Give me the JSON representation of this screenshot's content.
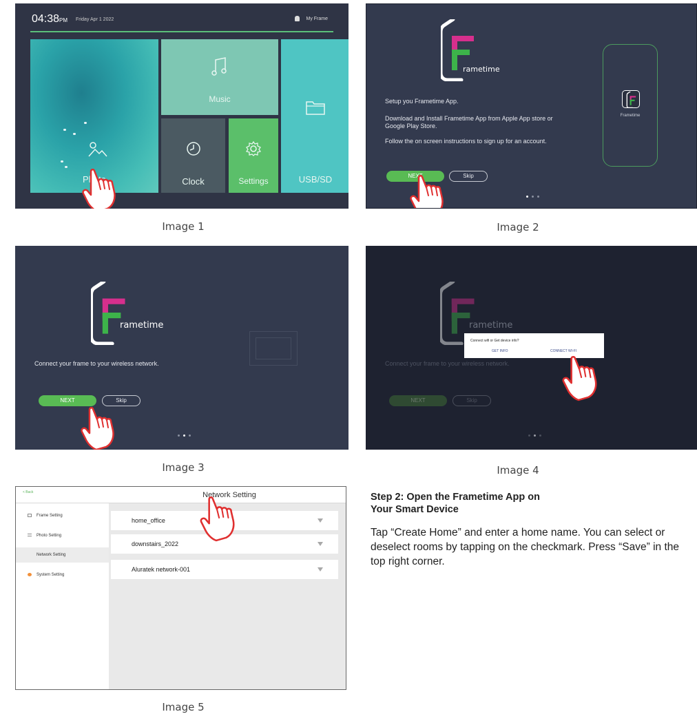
{
  "image1": {
    "time": "04:38",
    "ampm": "PM",
    "date": "Friday Apr 1 2022",
    "user_label": "My Frame",
    "tiles": {
      "photo": "Photo",
      "music": "Music",
      "clock": "Clock",
      "settings": "Settings",
      "usb": "USB/SD"
    },
    "caption": "Image 1"
  },
  "image2": {
    "logo_text": "rametime",
    "phone_app_label": "Frametime",
    "line1": "Setup you Frametime App.",
    "line2": "Download and Install Frametime App from Apple App store or Google Play Store.",
    "line3": "Follow the on screen instructions to sign up for an account.",
    "next_label": "NEXT",
    "skip_label": "Skip",
    "caption": "Image 2"
  },
  "image3": {
    "logo_text": "rametime",
    "message": "Connect your frame to your wireless network.",
    "next_label": "NEXT",
    "skip_label": "Skip",
    "caption": "Image 3"
  },
  "image4": {
    "logo_text": "rametime",
    "message": "Connect your frame to your wireless network.",
    "next_label": "NEXT",
    "skip_label": "Skip",
    "dialog_message": "Connect wifi or Get device info?",
    "dialog_get_info": "GET INFO",
    "dialog_connect_wifi": "CONNECT WI-FI",
    "caption": "Image 4"
  },
  "image5": {
    "back_label": "< Back",
    "title": "Network Setting",
    "sidebar": [
      "Frame Setting",
      "Photo Setting",
      "Network Setting",
      "System Setting"
    ],
    "networks": [
      "home_office",
      "downstairs_2022",
      "Aluratek network-001"
    ],
    "caption": "Image 5"
  },
  "step": {
    "heading": "Step 2: Open the Frametime App on Your Smart Device",
    "body": "Tap “Create Home” and enter a home name. You can select or deselect rooms by tapping on the checkmark. Press “Save” in the top right corner."
  },
  "colors": {
    "accent_green": "#59bb54",
    "logo_magenta": "#d62f8d",
    "screen_bg": "#333a4e",
    "hand_red": "#e03030"
  }
}
